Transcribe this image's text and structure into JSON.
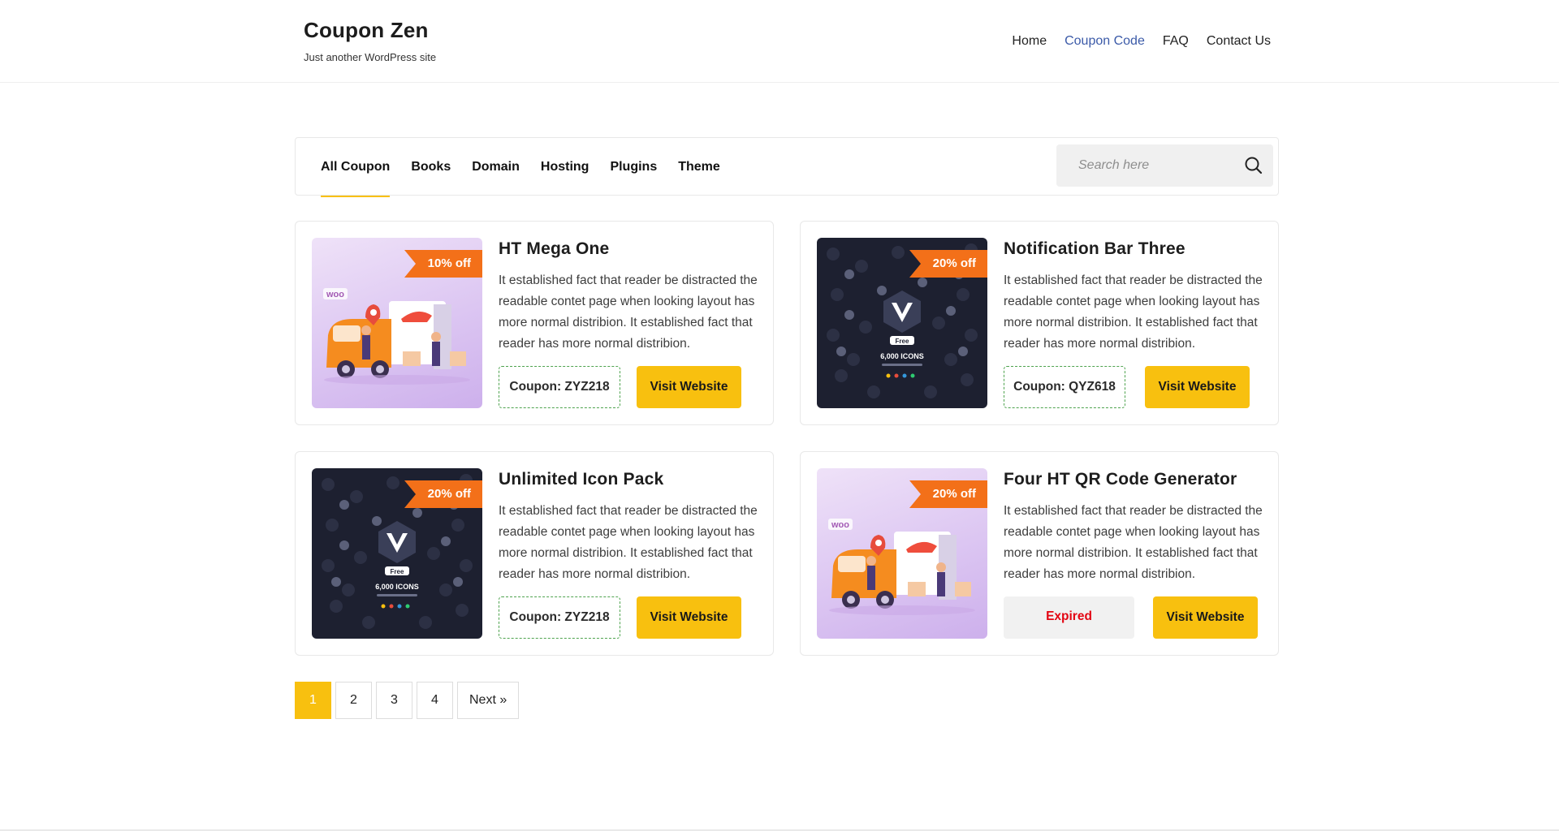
{
  "site": {
    "title": "Coupon Zen",
    "tagline": "Just another WordPress site"
  },
  "nav": {
    "items": [
      {
        "label": "Home",
        "active": false
      },
      {
        "label": "Coupon Code",
        "active": true
      },
      {
        "label": "FAQ",
        "active": false
      },
      {
        "label": "Contact Us",
        "active": false
      }
    ],
    "active_color": "#3b5aa8"
  },
  "filters": {
    "tabs": [
      {
        "label": "All Coupon",
        "active": true
      },
      {
        "label": "Books",
        "active": false
      },
      {
        "label": "Domain",
        "active": false
      },
      {
        "label": "Hosting",
        "active": false
      },
      {
        "label": "Plugins",
        "active": false
      },
      {
        "label": "Theme",
        "active": false
      }
    ],
    "search_placeholder": "Search here",
    "search_icon": "search-icon"
  },
  "coupons": [
    {
      "title": "HT Mega One",
      "discount": "10% off",
      "image": "woo-delivery-truck-illustration",
      "woo_label": "woo",
      "description": "It established fact that reader be distracted the readable contet page when looking layout has more normal distribion. It established fact that reader has more normal distribion.",
      "coupon": "Coupon: ZYZ218",
      "expired": false,
      "visit_label": "Visit Website"
    },
    {
      "title": "Notification Bar Three",
      "discount": "20% off",
      "image": "icon-pack-dark-illustration",
      "free_label": "Free",
      "icons_label": "6,000 ICONS",
      "description": "It established fact that reader be distracted the readable contet page when looking layout has more normal distribion. It established fact that reader has more normal distribion.",
      "coupon": "Coupon: QYZ618",
      "expired": false,
      "visit_label": "Visit Website"
    },
    {
      "title": "Unlimited Icon Pack",
      "discount": "20% off",
      "image": "icon-pack-dark-illustration",
      "free_label": "Free",
      "icons_label": "6,000 ICONS",
      "description": "It established fact that reader be distracted the readable contet page when looking layout has more normal distribion. It established fact that reader has more normal distribion.",
      "coupon": "Coupon: ZYZ218",
      "expired": false,
      "visit_label": "Visit Website"
    },
    {
      "title": "Four HT QR Code Generator",
      "discount": "20% off",
      "image": "woo-delivery-truck-illustration",
      "woo_label": "woo",
      "description": "It established fact that reader be distracted the readable contet page when looking layout has more normal distribion. It established fact that reader has more normal distribion.",
      "coupon": "Expired",
      "expired": true,
      "visit_label": "Visit Website"
    }
  ],
  "pagination": {
    "pages": [
      "1",
      "2",
      "3",
      "4"
    ],
    "current": "1",
    "next_label": "Next »"
  },
  "colors": {
    "accent": "#f8c00f",
    "ribbon": "#f37019",
    "expired": "#e30613",
    "coupon_border": "#4ea34e"
  }
}
